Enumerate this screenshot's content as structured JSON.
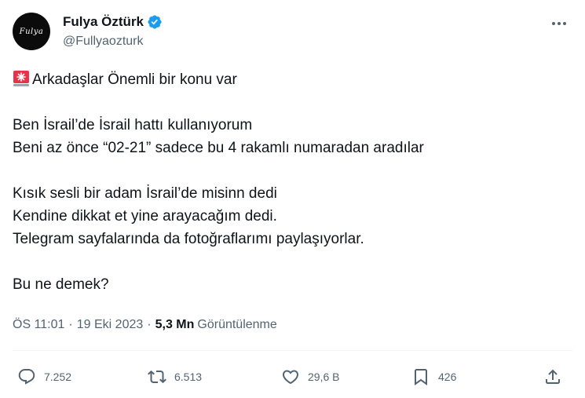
{
  "author": {
    "display_name": "Fulya Öztürk",
    "handle": "@Fullyaozturk",
    "avatar_text": "Fulya",
    "verified": true
  },
  "tweet": {
    "emoji": "alarm-light",
    "line1": "Arkadaşlar Önemli bir konu var",
    "line2": "Ben İsrail’de İsrail hattı kullanıyorum",
    "line3": "Beni az önce “02-21” sadece bu 4 rakamlı numaradan aradılar",
    "line4": "Kısık sesli bir adam İsrail’de misinn dedi",
    "line5": "Kendine dikkat et yine arayacağım dedi.",
    "line6": "Telegram sayfalarında da fotoğraflarımı paylaşıyorlar.",
    "line7": "Bu ne demek?"
  },
  "meta": {
    "time": "ÖS 11:01",
    "separator": "·",
    "date": "19 Eki 2023",
    "views_count": "5,3 Mn",
    "views_label": "Görüntülenme"
  },
  "actions": {
    "replies": "7.252",
    "retweets": "6.513",
    "likes": "29,6 B",
    "bookmarks": "426"
  },
  "colors": {
    "text": "#0f1419",
    "secondary": "#536471",
    "verified": "#1d9bf0",
    "divider": "#eff3f4"
  }
}
